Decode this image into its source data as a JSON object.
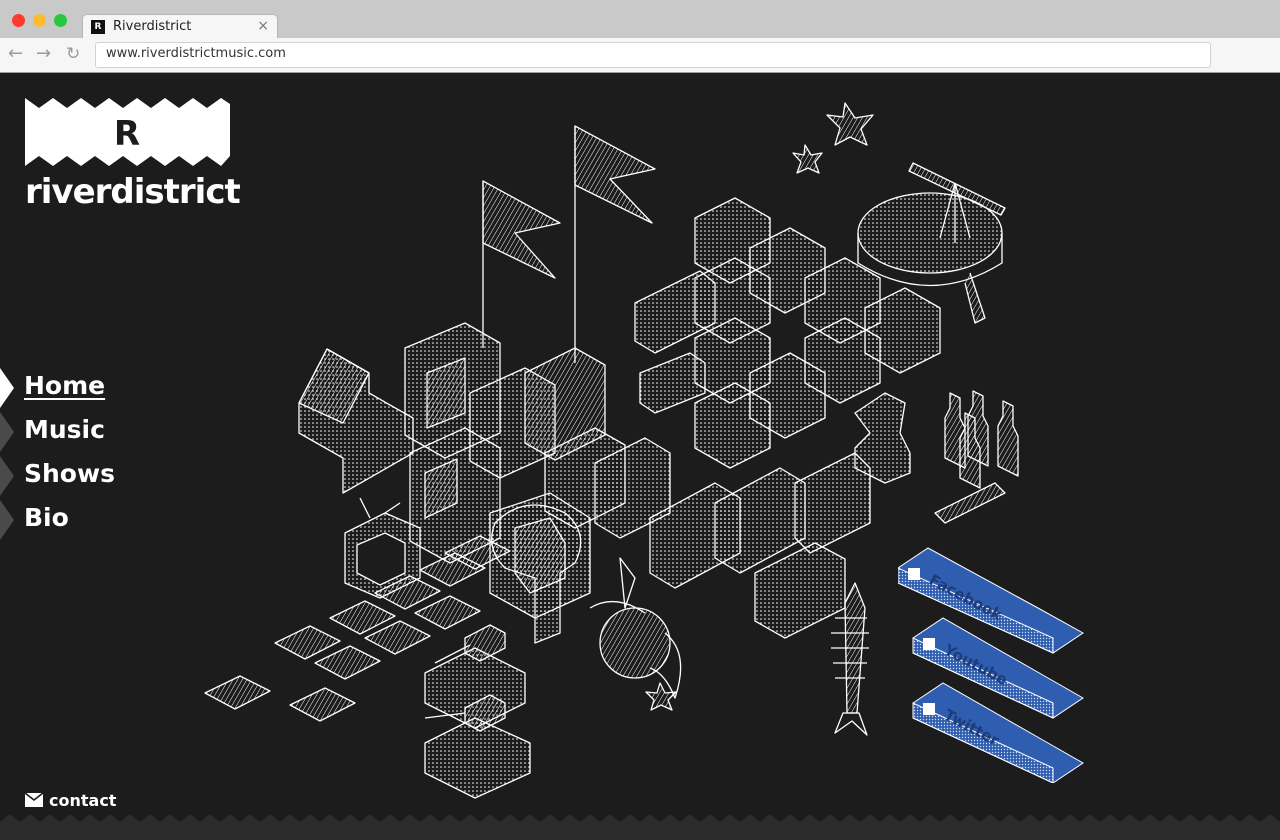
{
  "browser": {
    "tab_title": "Riverdistrict",
    "favicon_letter": "R",
    "url": "www.riverdistrictmusic.com",
    "close_glyph": "×",
    "back_glyph": "←",
    "forward_glyph": "→",
    "reload_glyph": "↻"
  },
  "logo": {
    "letter": "R",
    "wordmark": "riverdistrict"
  },
  "nav": {
    "items": [
      {
        "label": "Home",
        "active": true
      },
      {
        "label": "Music",
        "active": false
      },
      {
        "label": "Shows",
        "active": false
      },
      {
        "label": "Bio",
        "active": false
      }
    ]
  },
  "social": {
    "facebook": "Facebook",
    "youtube": "Youtube",
    "twitter": "Twitter",
    "color": "#2f5eb0"
  },
  "contact": {
    "label": "contact",
    "icon": "envelope-icon"
  },
  "colors": {
    "background": "#1c1c1c",
    "foreground": "#ffffff",
    "accent": "#2f5eb0"
  }
}
